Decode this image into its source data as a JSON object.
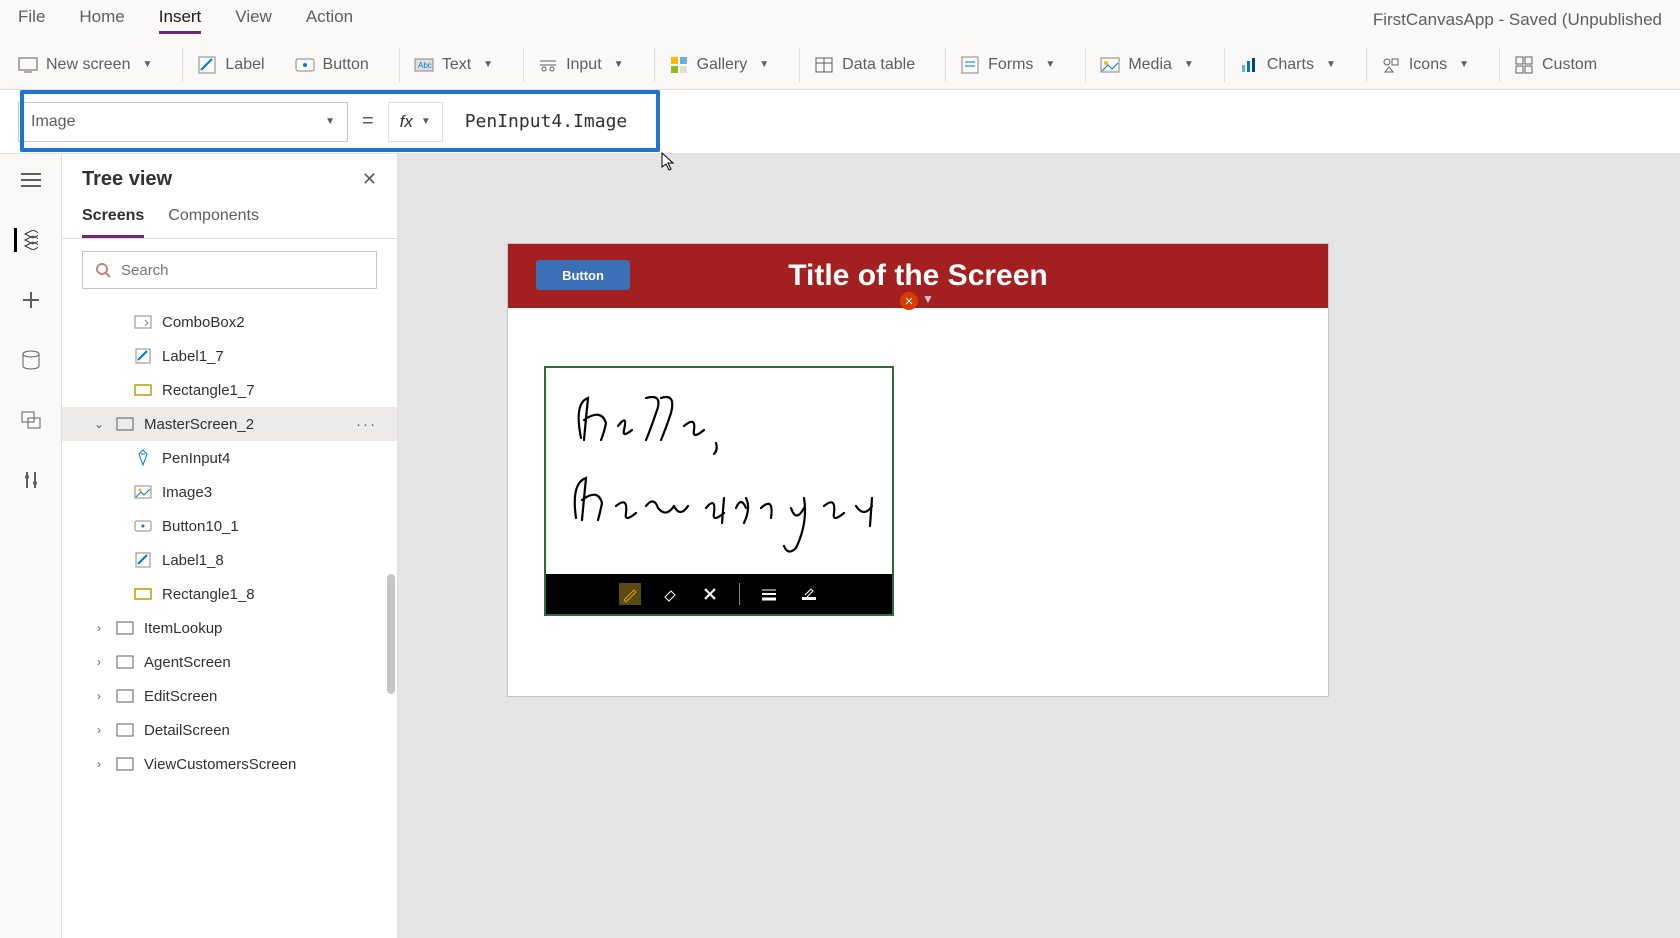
{
  "menu": {
    "items": [
      "File",
      "Home",
      "Insert",
      "View",
      "Action"
    ],
    "active": 2,
    "app_title": "FirstCanvasApp - Saved (Unpublished"
  },
  "ribbon": {
    "new_screen": "New screen",
    "label": "Label",
    "button": "Button",
    "text": "Text",
    "input": "Input",
    "gallery": "Gallery",
    "data_table": "Data table",
    "forms": "Forms",
    "media": "Media",
    "charts": "Charts",
    "icons": "Icons",
    "custom": "Custom"
  },
  "formula": {
    "property": "Image",
    "equals": "=",
    "fx": "fx",
    "expression": "PenInput4.Image"
  },
  "tree": {
    "title": "Tree view",
    "tabs": [
      "Screens",
      "Components"
    ],
    "active_tab": 0,
    "search_placeholder": "Search",
    "items": [
      {
        "depth": 1,
        "icon": "combobox",
        "label": "ComboBox2"
      },
      {
        "depth": 1,
        "icon": "label",
        "label": "Label1_7"
      },
      {
        "depth": 1,
        "icon": "rect",
        "label": "Rectangle1_7"
      },
      {
        "depth": 0,
        "icon": "screen",
        "label": "MasterScreen_2",
        "expanded": true,
        "selected": true,
        "dots": true
      },
      {
        "depth": 1,
        "icon": "pen",
        "label": "PenInput4"
      },
      {
        "depth": 1,
        "icon": "image",
        "label": "Image3"
      },
      {
        "depth": 1,
        "icon": "button",
        "label": "Button10_1"
      },
      {
        "depth": 1,
        "icon": "label",
        "label": "Label1_8"
      },
      {
        "depth": 1,
        "icon": "rect",
        "label": "Rectangle1_8"
      },
      {
        "depth": 0,
        "icon": "screen",
        "label": "ItemLookup"
      },
      {
        "depth": 0,
        "icon": "screen",
        "label": "AgentScreen"
      },
      {
        "depth": 0,
        "icon": "screen",
        "label": "EditScreen"
      },
      {
        "depth": 0,
        "icon": "screen",
        "label": "DetailScreen"
      },
      {
        "depth": 0,
        "icon": "screen",
        "label": "ViewCustomersScreen"
      }
    ]
  },
  "canvas": {
    "header_title": "Title of the Screen",
    "header_button": "Button",
    "handwriting_lines": [
      "Hello,",
      "How are you"
    ]
  },
  "colors": {
    "accent": "#742774",
    "header_bg": "#a41f1f",
    "pen_border": "#2e6b3e",
    "highlight": "#1f74d1"
  }
}
